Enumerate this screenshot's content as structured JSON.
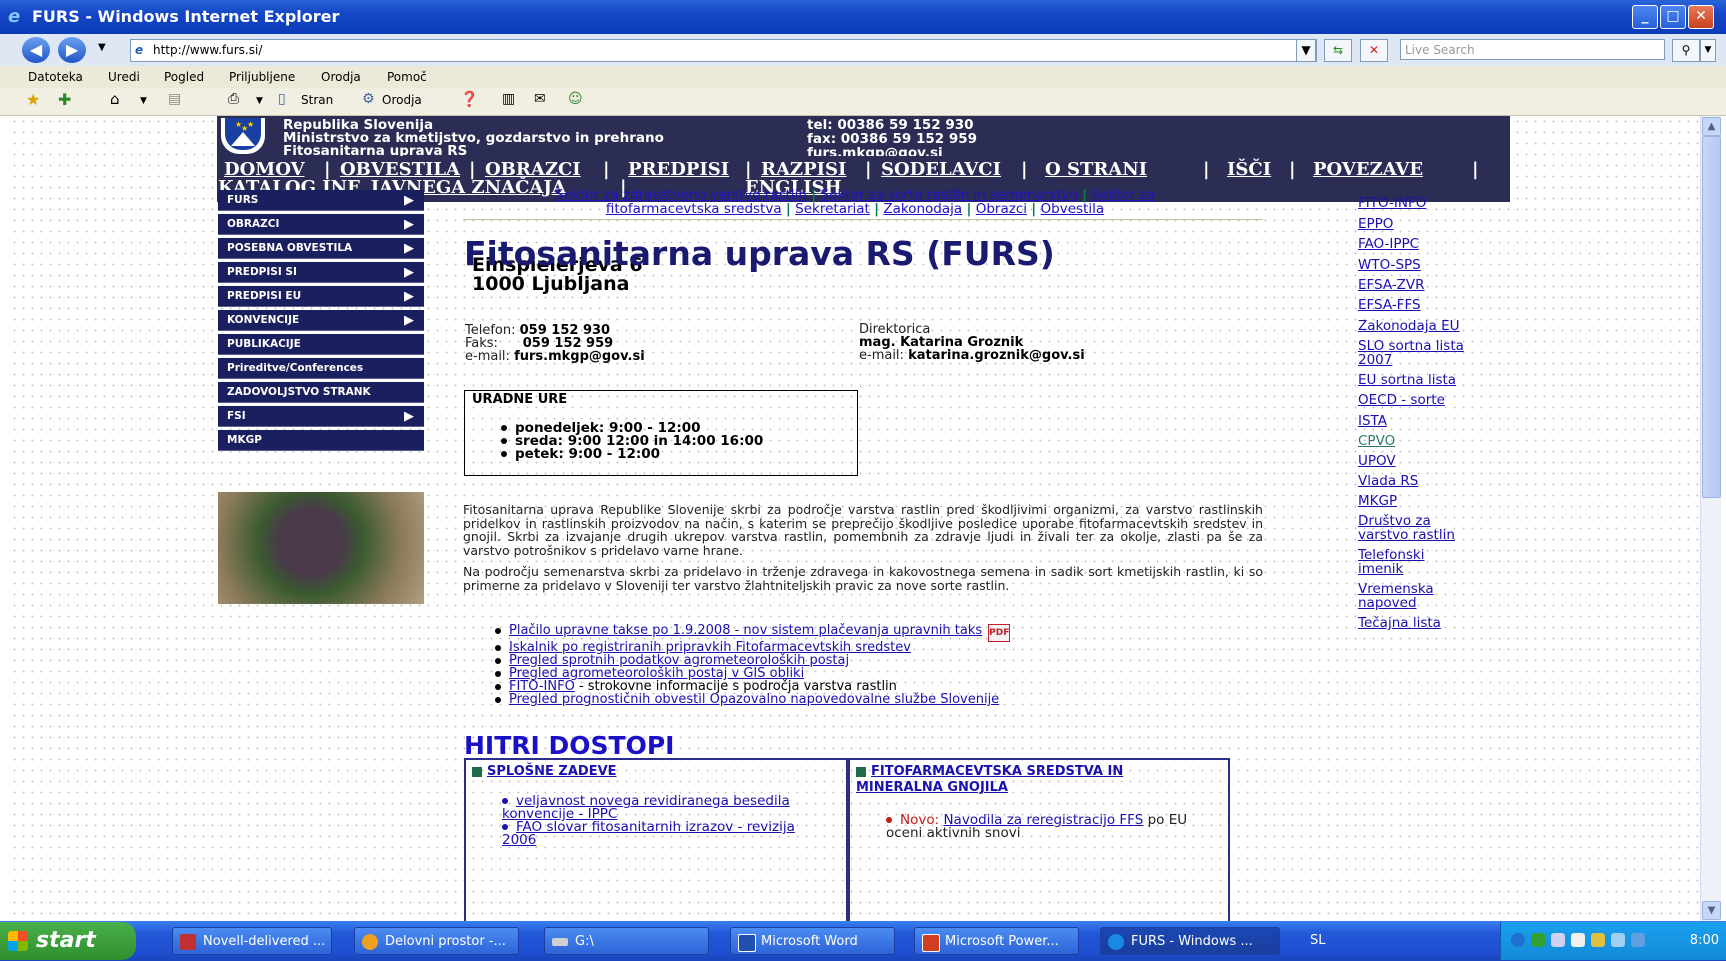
{
  "window": {
    "title": "FURS - Windows Internet Explorer",
    "url": "http://www.furs.si/",
    "search_placeholder": "Live Search",
    "minimize": "_",
    "maximize": "□",
    "close": "✕"
  },
  "menubar": [
    "Datoteka",
    "Uredi",
    "Pogled",
    "Priljubljene",
    "Orodja",
    "Pomoč"
  ],
  "toolbar": {
    "page": "Stran",
    "tools": "Orodja"
  },
  "header": {
    "line1": "Republika Slovenija",
    "line2": "Ministrstvo za kmetijstvo, gozdarstvo in prehrano",
    "line3": "Fitosanitarna uprava RS",
    "tel": "tel: 00386 59 152 930",
    "fax": "fax: 00386 59 152 959",
    "email": "furs.mkgp@gov.si"
  },
  "mainnav": [
    "DOMOV",
    "OBVESTILA",
    "OBRAZCI",
    "PREDPISI",
    "RAZPISI",
    "SODELAVCI",
    "O STRANI",
    "IŠČI",
    "POVEZAVE",
    "KATALOG INF. JAVNEGA ZNAČAJA",
    "ENGLISH"
  ],
  "leftmenu": [
    {
      "label": "FURS",
      "arrow": "▶"
    },
    {
      "label": "OBRAZCI",
      "arrow": "▶"
    },
    {
      "label": "POSEBNA OBVESTILA",
      "arrow": "▶"
    },
    {
      "label": "PREDPISI SI",
      "arrow": "▶"
    },
    {
      "label": "PREDPISI EU",
      "arrow": "▶"
    },
    {
      "label": "KONVENCIJE",
      "arrow": "▶"
    },
    {
      "label": "PUBLIKACIJE",
      "arrow": ""
    },
    {
      "label": "Prireditve/Conferences",
      "arrow": ""
    },
    {
      "label": "ZADOVOLJSTVO STRANK",
      "arrow": ""
    },
    {
      "label": "FSI",
      "arrow": "▶"
    },
    {
      "label": "MKGP",
      "arrow": ""
    }
  ],
  "subnav": {
    "links": [
      "Sektor za zdravstveno varstvo rastlin",
      "Sektor za sorte rastlin in semenarstvo",
      "Sektor za",
      "fitofarmacevtska sredstva",
      "Sekretariat",
      "Zakonodaja",
      "Obrazci",
      "Obvestila"
    ],
    "separator": "|"
  },
  "main": {
    "title": "Fitosanitarna uprava RS (FURS)",
    "address_street": "Einspielerjeva 6",
    "address_city": "1000 Ljubljana",
    "tel_label": "Telefon:",
    "tel_value": "059 152 930",
    "fax_label": "Faks:",
    "fax_value": "059 152 959",
    "email_label": "e-mail:",
    "email_value": "furs.mkgp@gov.si",
    "director_label": "Direktorica",
    "director_name": "mag. Katarina Groznik",
    "director_email_label": "e-mail:",
    "director_email": "katarina.groznik@gov.si",
    "hours_title": "URADNE URE",
    "hours": [
      "ponedeljek: 9:00 - 12:00",
      "sreda: 9:00   12:00 in 14:00   16:00",
      "petek: 9:00 - 12:00"
    ],
    "para1": "Fitosanitarna uprava Republike Slovenije skrbi za področje varstva rastlin pred škodljivimi organizmi, za varstvo rastlinskih pridelkov in rastlinskih proizvodov na način, s katerim se preprečijo škodljive posledice uporabe fitofarmacevtskih sredstev in gnojil. Skrbi za izvajanje drugih ukrepov varstva rastlin, pomembnih za zdravje ljudi in živali ter za okolje, zlasti pa še za varstvo potrošnikov s pridelavo varne hrane.",
    "para2": "Na področju semenarstva skrbi za pridelavo in trženje zdravega in kakovostnega semena in sadik sort kmetijskih rastlin, ki so primerne za pridelavo v Sloveniji ter varstvo žlahtniteljskih pravic za nove sorte rastlin.",
    "links": [
      {
        "text": "Plačilo upravne takse po 1.9.2008 - nov sistem plačevanja upravnih taks",
        "suffix": ""
      },
      {
        "text": "Iskalnik po registriranih pripravkih Fitofarmacevtskih sredstev",
        "suffix": ""
      },
      {
        "text": "Pregled sprotnih podatkov agrometeoroloških postaj",
        "suffix": ""
      },
      {
        "text": "Pregled agrometeoroloških postaj v GIS obliki",
        "suffix": ""
      },
      {
        "text": "FITO-INFO",
        "suffix": " - strokovne informacije s področja varstva rastlin"
      },
      {
        "text": "Pregled prognostičnih obvestil Opazovalno napovedovalne službe Slovenije",
        "suffix": ""
      }
    ],
    "pdf_icon": "PDF",
    "hitri_title": "HITRI DOSTOPI",
    "box1_title": "SPLOŠNE ZADEVE",
    "box1_items": [
      "veljavnost novega revidiranega besedila konvencije - IPPC",
      "FAO slovar fitosanitarnih izrazov - revizija 2006"
    ],
    "box2_title_a": "FITOFARMACEVTSKA SREDSTVA IN",
    "box2_title_b": "MINERALNA GNOJILA",
    "box2_new": "Novo:",
    "box2_link": "Navodila za reregistracijo FFS",
    "box2_rest": " po EU oceni aktivnih snovi"
  },
  "rightlinks": [
    "FITO-INFO",
    "EPPO",
    "FAO-IPPC",
    "WTO-SPS",
    "EFSA-ZVR",
    "EFSA-FFS",
    "Zakonodaja EU",
    "SLO sortna lista 2007",
    "EU sortna lista",
    "OECD - sorte",
    "ISTA",
    "CPVO",
    "UPOV",
    "Vlada RS",
    "MKGP",
    "Društvo za varstvo rastlin",
    "Telefonski imenik",
    "Vremenska napoved",
    "Tečajna lista"
  ],
  "taskbar": {
    "start": "start",
    "tasks": [
      "Novell-delivered ...",
      "Delovni prostor -...",
      "G:\\",
      "Microsoft Word",
      "Microsoft Power...",
      "FURS - Windows ..."
    ],
    "lang": "SL",
    "clock": "8:00"
  },
  "colors": {
    "header_bg": "#2b2d55",
    "menu_bg": "#1a1f60",
    "link": "#1a10b0",
    "hitri": "#1a10c8"
  }
}
